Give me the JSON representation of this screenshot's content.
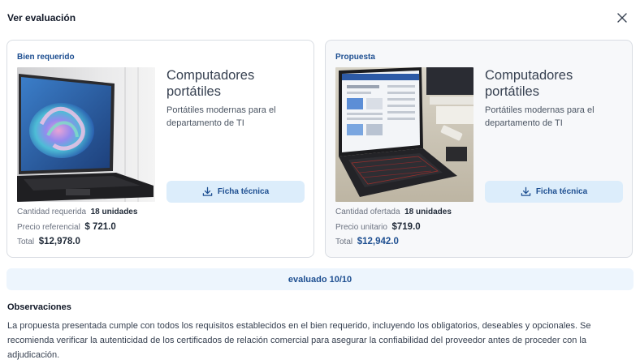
{
  "modal": {
    "title": "Ver evaluación",
    "close_icon": "close-icon"
  },
  "required": {
    "tag": "Bien requerido",
    "image": "laptop-photo-colorful-wallpaper",
    "title": "Computadores portátiles",
    "description": "Portátiles modernas para el departamento de TI",
    "spec_button": "Ficha técnica",
    "quantity_label": "Cantidad requerida",
    "quantity_value": "18 unidades",
    "price_label": "Precio referencial",
    "price_value": "$ 721.0",
    "total_label": "Total",
    "total_value": "$12,978.0"
  },
  "proposal": {
    "tag": "Propuesta",
    "image": "laptop-photo-on-desk-browser-open",
    "title": "Computadores portátiles",
    "description": "Portátiles modernas para el departamento de TI",
    "spec_button": "Ficha técnica",
    "quantity_label": "Cantidad ofertada",
    "quantity_value": "18 unidades",
    "price_label": "Precio unitario",
    "price_value": "$719.0",
    "total_label": "Total",
    "total_value": "$12,942.0"
  },
  "evaluation": {
    "score_text": "evaluado 10/10"
  },
  "observations": {
    "title": "Observaciones",
    "text": "La propuesta presentada cumple con todos los requisitos establecidos en el bien requerido, incluyendo los obligatorios, deseables y opcionales. Se recomienda verificar la autenticidad de los certificados de relación comercial para asegurar la confiabilidad del proveedor antes de proceder con la adjudicación."
  },
  "colors": {
    "accent": "#1e4f91",
    "button_bg": "#dcedfb",
    "score_bg": "#edf5fd",
    "border": "#d9dde3"
  }
}
